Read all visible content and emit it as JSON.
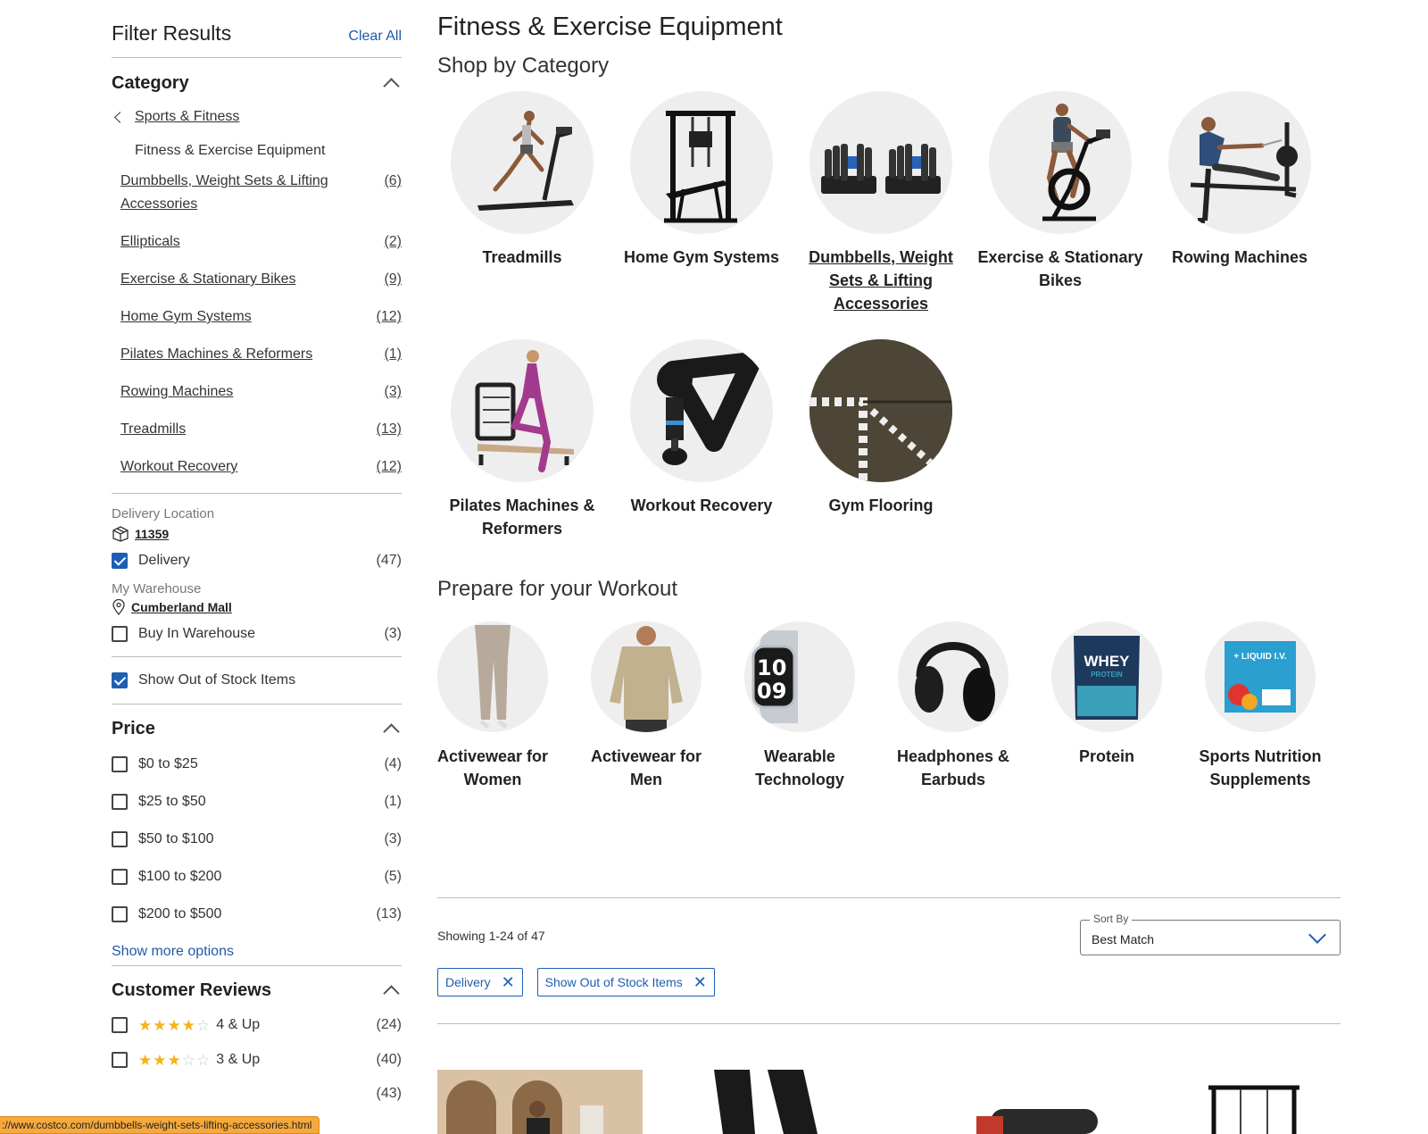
{
  "sidebar": {
    "title": "Filter Results",
    "clear_all": "Clear All",
    "category": {
      "heading": "Category",
      "back_link": "Sports & Fitness",
      "current": "Fitness & Exercise Equipment",
      "items": [
        {
          "label": "Dumbbells, Weight Sets & Lifting Accessories",
          "count": "(6)"
        },
        {
          "label": "Ellipticals",
          "count": "(2)"
        },
        {
          "label": "Exercise & Stationary Bikes",
          "count": "(9)"
        },
        {
          "label": "Home Gym Systems",
          "count": "(12)"
        },
        {
          "label": "Pilates Machines & Reformers",
          "count": "(1)"
        },
        {
          "label": "Rowing Machines",
          "count": "(3)"
        },
        {
          "label": "Treadmills",
          "count": "(13)"
        },
        {
          "label": "Workout Recovery",
          "count": "(12)"
        }
      ]
    },
    "delivery": {
      "label": "Delivery Location",
      "zip": "11359",
      "option": "Delivery",
      "count": "(47)",
      "checked": true
    },
    "warehouse": {
      "label": "My Warehouse",
      "name": "Cumberland Mall",
      "option": "Buy In Warehouse",
      "count": "(3)",
      "checked": false
    },
    "out_of_stock": {
      "label": "Show Out of Stock Items",
      "checked": true
    },
    "price": {
      "heading": "Price",
      "options": [
        {
          "label": "$0 to $25",
          "count": "(4)"
        },
        {
          "label": "$25 to $50",
          "count": "(1)"
        },
        {
          "label": "$50 to $100",
          "count": "(3)"
        },
        {
          "label": "$100 to $200",
          "count": "(5)"
        },
        {
          "label": "$200 to $500",
          "count": "(13)"
        }
      ],
      "show_more": "Show more options"
    },
    "reviews": {
      "heading": "Customer Reviews",
      "options": [
        {
          "label": "4 & Up",
          "count": "(24)",
          "stars": 4
        },
        {
          "label": "3 & Up",
          "count": "(40)",
          "stars": 3
        },
        {
          "count": "(43)"
        }
      ]
    }
  },
  "main": {
    "title": "Fitness & Exercise Equipment",
    "shop_by_category": "Shop by Category",
    "categories": [
      {
        "label": "Treadmills",
        "icon": "treadmill-icon"
      },
      {
        "label": "Home Gym Systems",
        "icon": "home-gym-icon"
      },
      {
        "label": "Dumbbells, Weight Sets & Lifting Accessories",
        "icon": "dumbbell-icon"
      },
      {
        "label": "Exercise & Stationary Bikes",
        "icon": "bike-icon"
      },
      {
        "label": "Rowing Machines",
        "icon": "rowing-icon"
      },
      {
        "label": "Pilates Machines & Reformers",
        "icon": "pilates-icon"
      },
      {
        "label": "Workout Recovery",
        "icon": "massage-gun-icon"
      },
      {
        "label": "Gym Flooring",
        "icon": "flooring-icon"
      }
    ],
    "prepare_heading": "Prepare for your Workout",
    "prepare": [
      {
        "label": "Activewear for Women",
        "icon": "leggings-icon"
      },
      {
        "label": "Activewear for Men",
        "icon": "hoodie-icon"
      },
      {
        "label": "Wearable Technology",
        "icon": "watch-icon"
      },
      {
        "label": "Headphones & Earbuds",
        "icon": "headphones-icon"
      },
      {
        "label": "Protein",
        "icon": "protein-icon",
        "pack_title": "WHEY",
        "pack_sub": "PROTEIN"
      },
      {
        "label": "Sports Nutrition Supplements",
        "icon": "supplement-icon",
        "pack_title": "+ LIQUID I.V."
      }
    ],
    "showing": "Showing 1-24 of 47",
    "sort": {
      "label": "Sort By",
      "value": "Best Match"
    },
    "chips": [
      "Delivery",
      "Show Out of Stock Items"
    ]
  },
  "status_url": "://www.costco.com/dumbbells-weight-sets-lifting-accessories.html"
}
